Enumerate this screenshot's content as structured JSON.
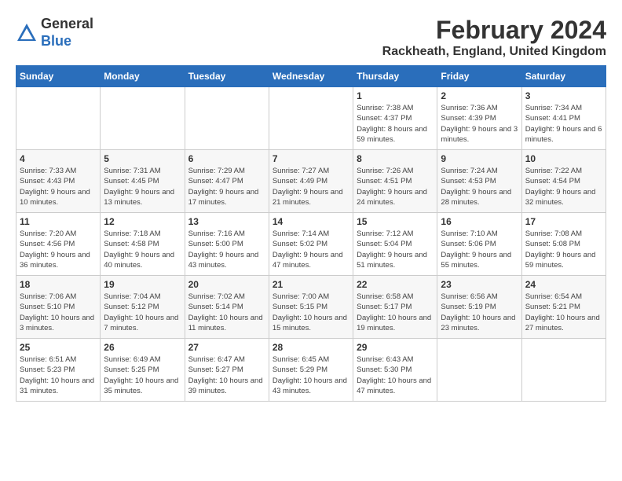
{
  "header": {
    "logo_general": "General",
    "logo_blue": "Blue",
    "month_year": "February 2024",
    "location": "Rackheath, England, United Kingdom"
  },
  "days_of_week": [
    "Sunday",
    "Monday",
    "Tuesday",
    "Wednesday",
    "Thursday",
    "Friday",
    "Saturday"
  ],
  "weeks": [
    [
      {
        "day": "",
        "info": ""
      },
      {
        "day": "",
        "info": ""
      },
      {
        "day": "",
        "info": ""
      },
      {
        "day": "",
        "info": ""
      },
      {
        "day": "1",
        "info": "Sunrise: 7:38 AM\nSunset: 4:37 PM\nDaylight: 8 hours\nand 59 minutes."
      },
      {
        "day": "2",
        "info": "Sunrise: 7:36 AM\nSunset: 4:39 PM\nDaylight: 9 hours\nand 3 minutes."
      },
      {
        "day": "3",
        "info": "Sunrise: 7:34 AM\nSunset: 4:41 PM\nDaylight: 9 hours\nand 6 minutes."
      }
    ],
    [
      {
        "day": "4",
        "info": "Sunrise: 7:33 AM\nSunset: 4:43 PM\nDaylight: 9 hours\nand 10 minutes."
      },
      {
        "day": "5",
        "info": "Sunrise: 7:31 AM\nSunset: 4:45 PM\nDaylight: 9 hours\nand 13 minutes."
      },
      {
        "day": "6",
        "info": "Sunrise: 7:29 AM\nSunset: 4:47 PM\nDaylight: 9 hours\nand 17 minutes."
      },
      {
        "day": "7",
        "info": "Sunrise: 7:27 AM\nSunset: 4:49 PM\nDaylight: 9 hours\nand 21 minutes."
      },
      {
        "day": "8",
        "info": "Sunrise: 7:26 AM\nSunset: 4:51 PM\nDaylight: 9 hours\nand 24 minutes."
      },
      {
        "day": "9",
        "info": "Sunrise: 7:24 AM\nSunset: 4:53 PM\nDaylight: 9 hours\nand 28 minutes."
      },
      {
        "day": "10",
        "info": "Sunrise: 7:22 AM\nSunset: 4:54 PM\nDaylight: 9 hours\nand 32 minutes."
      }
    ],
    [
      {
        "day": "11",
        "info": "Sunrise: 7:20 AM\nSunset: 4:56 PM\nDaylight: 9 hours\nand 36 minutes."
      },
      {
        "day": "12",
        "info": "Sunrise: 7:18 AM\nSunset: 4:58 PM\nDaylight: 9 hours\nand 40 minutes."
      },
      {
        "day": "13",
        "info": "Sunrise: 7:16 AM\nSunset: 5:00 PM\nDaylight: 9 hours\nand 43 minutes."
      },
      {
        "day": "14",
        "info": "Sunrise: 7:14 AM\nSunset: 5:02 PM\nDaylight: 9 hours\nand 47 minutes."
      },
      {
        "day": "15",
        "info": "Sunrise: 7:12 AM\nSunset: 5:04 PM\nDaylight: 9 hours\nand 51 minutes."
      },
      {
        "day": "16",
        "info": "Sunrise: 7:10 AM\nSunset: 5:06 PM\nDaylight: 9 hours\nand 55 minutes."
      },
      {
        "day": "17",
        "info": "Sunrise: 7:08 AM\nSunset: 5:08 PM\nDaylight: 9 hours\nand 59 minutes."
      }
    ],
    [
      {
        "day": "18",
        "info": "Sunrise: 7:06 AM\nSunset: 5:10 PM\nDaylight: 10 hours\nand 3 minutes."
      },
      {
        "day": "19",
        "info": "Sunrise: 7:04 AM\nSunset: 5:12 PM\nDaylight: 10 hours\nand 7 minutes."
      },
      {
        "day": "20",
        "info": "Sunrise: 7:02 AM\nSunset: 5:14 PM\nDaylight: 10 hours\nand 11 minutes."
      },
      {
        "day": "21",
        "info": "Sunrise: 7:00 AM\nSunset: 5:15 PM\nDaylight: 10 hours\nand 15 minutes."
      },
      {
        "day": "22",
        "info": "Sunrise: 6:58 AM\nSunset: 5:17 PM\nDaylight: 10 hours\nand 19 minutes."
      },
      {
        "day": "23",
        "info": "Sunrise: 6:56 AM\nSunset: 5:19 PM\nDaylight: 10 hours\nand 23 minutes."
      },
      {
        "day": "24",
        "info": "Sunrise: 6:54 AM\nSunset: 5:21 PM\nDaylight: 10 hours\nand 27 minutes."
      }
    ],
    [
      {
        "day": "25",
        "info": "Sunrise: 6:51 AM\nSunset: 5:23 PM\nDaylight: 10 hours\nand 31 minutes."
      },
      {
        "day": "26",
        "info": "Sunrise: 6:49 AM\nSunset: 5:25 PM\nDaylight: 10 hours\nand 35 minutes."
      },
      {
        "day": "27",
        "info": "Sunrise: 6:47 AM\nSunset: 5:27 PM\nDaylight: 10 hours\nand 39 minutes."
      },
      {
        "day": "28",
        "info": "Sunrise: 6:45 AM\nSunset: 5:29 PM\nDaylight: 10 hours\nand 43 minutes."
      },
      {
        "day": "29",
        "info": "Sunrise: 6:43 AM\nSunset: 5:30 PM\nDaylight: 10 hours\nand 47 minutes."
      },
      {
        "day": "",
        "info": ""
      },
      {
        "day": "",
        "info": ""
      }
    ]
  ]
}
